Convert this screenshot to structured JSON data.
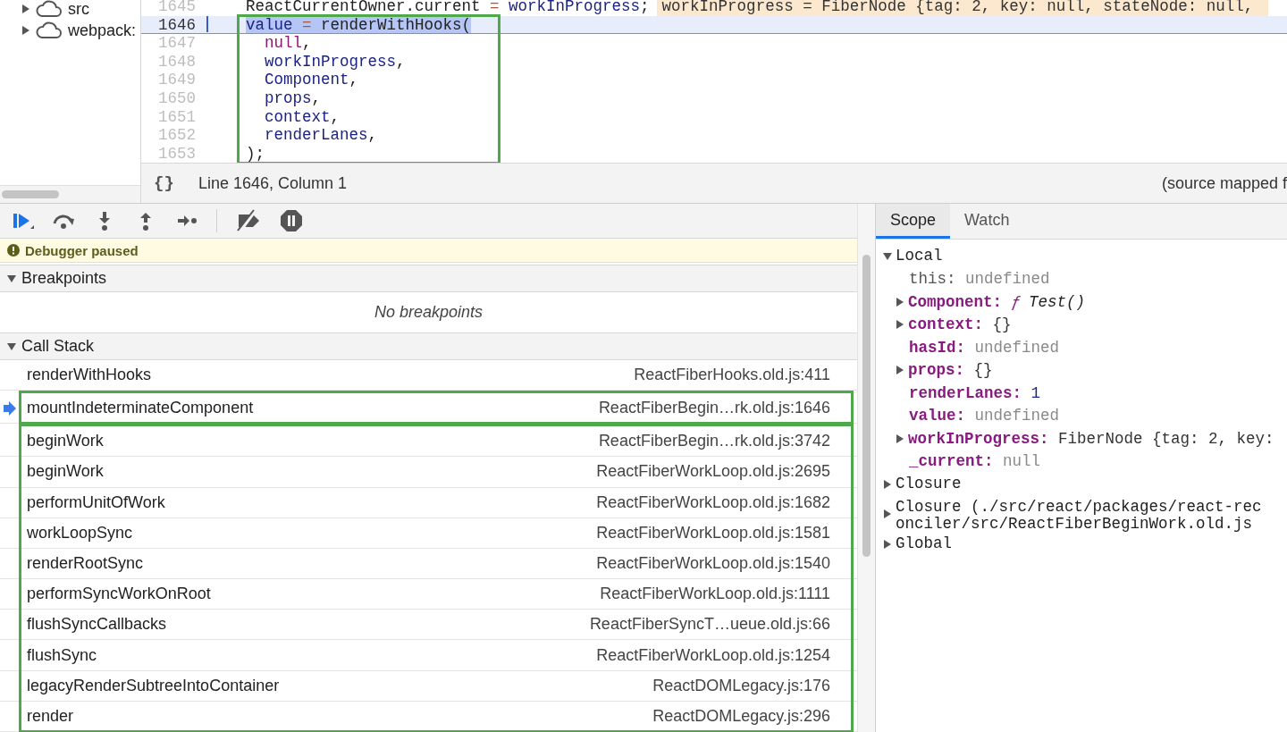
{
  "file_tree": {
    "items": [
      {
        "label": "src",
        "expanded": false
      },
      {
        "label": "webpack:",
        "expanded": false
      }
    ]
  },
  "editor": {
    "blocks": [
      {
        "outlined": false,
        "lines": [
          {
            "number": "1645",
            "current": false,
            "tokens": [
              {
                "text": "ReactCurrentOwner.current",
                "kind": "plain"
              },
              {
                "text": " = ",
                "kind": "op"
              },
              {
                "text": "workInProgress",
                "kind": "var"
              },
              {
                "text": ";",
                "kind": "plain"
              }
            ],
            "inline_value": "workInProgress = FiberNode {tag: 2, key: null, stateNode: null, "
          }
        ]
      },
      {
        "outlined": true,
        "lines": [
          {
            "number": "1646",
            "current": true,
            "tokens": [
              {
                "text": "value",
                "kind": "var"
              },
              {
                "text": " = ",
                "kind": "op"
              },
              {
                "text": "renderWithHooks(",
                "kind": "plain"
              }
            ]
          },
          {
            "number": "1647",
            "current": false,
            "tokens": [
              {
                "text": "  null",
                "kind": "keyword"
              },
              {
                "text": ",",
                "kind": "plain"
              }
            ]
          },
          {
            "number": "1648",
            "current": false,
            "tokens": [
              {
                "text": "  workInProgress",
                "kind": "var"
              },
              {
                "text": ",",
                "kind": "plain"
              }
            ]
          },
          {
            "number": "1649",
            "current": false,
            "tokens": [
              {
                "text": "  Component",
                "kind": "var"
              },
              {
                "text": ",",
                "kind": "plain"
              }
            ]
          },
          {
            "number": "1650",
            "current": false,
            "tokens": [
              {
                "text": "  props",
                "kind": "var"
              },
              {
                "text": ",",
                "kind": "plain"
              }
            ]
          },
          {
            "number": "1651",
            "current": false,
            "tokens": [
              {
                "text": "  context",
                "kind": "var"
              },
              {
                "text": ",",
                "kind": "plain"
              }
            ]
          },
          {
            "number": "1652",
            "current": false,
            "tokens": [
              {
                "text": "  renderLanes",
                "kind": "var"
              },
              {
                "text": ",",
                "kind": "plain"
              }
            ]
          },
          {
            "number": "1653",
            "current": false,
            "tokens": [
              {
                "text": ");",
                "kind": "plain"
              }
            ]
          }
        ]
      }
    ],
    "status": {
      "pretty_print": "{}",
      "position": "Line 1646, Column 1",
      "source_note": "(source mapped f"
    }
  },
  "debugger": {
    "banner": "Debugger paused",
    "breakpoints": {
      "title": "Breakpoints",
      "expanded": true,
      "empty_text": "No breakpoints"
    },
    "call_stack": {
      "title": "Call Stack",
      "expanded": true,
      "sections": [
        {
          "outlined": false,
          "frames": [
            {
              "function": "renderWithHooks",
              "location": "ReactFiberHooks.old.js:411",
              "selected": false
            }
          ]
        },
        {
          "outlined": true,
          "frames": [
            {
              "function": "mountIndeterminateComponent",
              "location": "ReactFiberBegin…rk.old.js:1646",
              "selected": true
            }
          ]
        },
        {
          "outlined": true,
          "frames": [
            {
              "function": "beginWork",
              "location": "ReactFiberBegin…rk.old.js:3742",
              "selected": false
            },
            {
              "function": "beginWork",
              "location": "ReactFiberWorkLoop.old.js:2695",
              "selected": false
            },
            {
              "function": "performUnitOfWork",
              "location": "ReactFiberWorkLoop.old.js:1682",
              "selected": false
            },
            {
              "function": "workLoopSync",
              "location": "ReactFiberWorkLoop.old.js:1581",
              "selected": false
            },
            {
              "function": "renderRootSync",
              "location": "ReactFiberWorkLoop.old.js:1540",
              "selected": false
            },
            {
              "function": "performSyncWorkOnRoot",
              "location": "ReactFiberWorkLoop.old.js:1111",
              "selected": false
            },
            {
              "function": "flushSyncCallbacks",
              "location": "ReactFiberSyncT…ueue.old.js:66",
              "selected": false
            },
            {
              "function": "flushSync",
              "location": "ReactFiberWorkLoop.old.js:1254",
              "selected": false
            },
            {
              "function": "legacyRenderSubtreeIntoContainer",
              "location": "ReactDOMLegacy.js:176",
              "selected": false
            },
            {
              "function": "render",
              "location": "ReactDOMLegacy.js:296",
              "selected": false
            }
          ]
        }
      ]
    }
  },
  "sidebar_tabs": [
    {
      "label": "Scope",
      "selected": true
    },
    {
      "label": "Watch",
      "selected": false
    }
  ],
  "scope": [
    {
      "label": "Local",
      "expanded": true,
      "children": [
        {
          "name": "this:",
          "value": "undefined",
          "kind": "dim",
          "own": false,
          "expandable": false
        },
        {
          "name": "Component:",
          "value": "Test()",
          "kind": "function",
          "function_mark": "ƒ",
          "own": true,
          "expandable": true
        },
        {
          "name": "context:",
          "value": "{}",
          "kind": "plain",
          "own": true,
          "expandable": true
        },
        {
          "name": "hasId:",
          "value": "undefined",
          "kind": "dim",
          "own": true,
          "expandable": false
        },
        {
          "name": "props:",
          "value": "{}",
          "kind": "plain",
          "own": true,
          "expandable": true
        },
        {
          "name": "renderLanes:",
          "value": "1",
          "kind": "number",
          "own": true,
          "expandable": false
        },
        {
          "name": "value:",
          "value": "undefined",
          "kind": "dim",
          "own": true,
          "expandable": false
        },
        {
          "name": "workInProgress:",
          "value": "FiberNode {tag: 2, key:",
          "kind": "plain",
          "own": true,
          "expandable": true
        },
        {
          "name": "_current:",
          "value": "null",
          "kind": "dim",
          "own": true,
          "expandable": false
        }
      ]
    },
    {
      "label": "Closure",
      "expanded": false
    },
    {
      "label": "Closure (./src/react/packages/react-reconciler/src/ReactFiberBeginWork.old.js",
      "expanded": false
    },
    {
      "label": "Global",
      "expanded": false
    }
  ]
}
